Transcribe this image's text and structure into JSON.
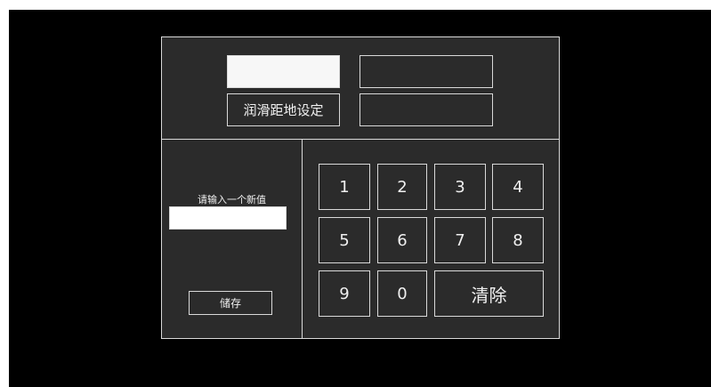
{
  "top": {
    "title_label": "润滑距地设定",
    "value_field": "",
    "display_1": "",
    "display_2": ""
  },
  "entry": {
    "prompt": "请输入一个新值",
    "input_value": "",
    "save_label": "储存"
  },
  "keypad": {
    "keys": [
      "1",
      "2",
      "3",
      "4",
      "5",
      "6",
      "7",
      "8",
      "9",
      "0"
    ],
    "clear_label": "清除"
  },
  "colors": {
    "background": "#000000",
    "panel": "#2b2b2b",
    "border": "#d9d9d9",
    "text": "#f0f0f0"
  }
}
